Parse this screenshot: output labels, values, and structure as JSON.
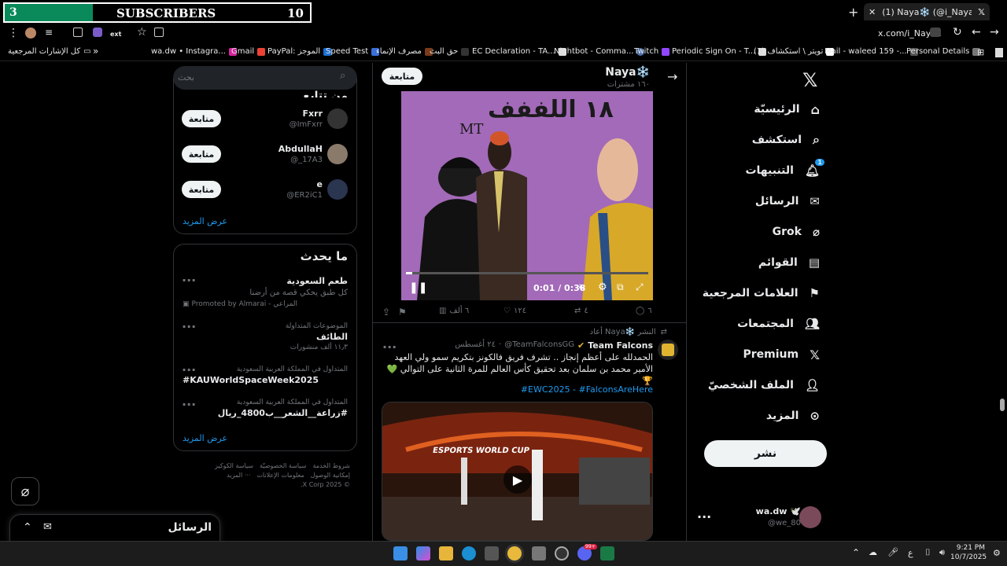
{
  "overlay": {
    "left": "3",
    "center": "SUBSCRIBERS",
    "right": "10"
  },
  "browser": {
    "tab_title": "(1) Naya❄️ (@i_Nayax) / X",
    "url": "x.com/i_Nayax",
    "new_tab": "+",
    "ext_label": "ext"
  },
  "bookmarks": [
    "كل الإشارات المرجعية",
    "wa.dw • Instagra...",
    "Gmail",
    "PayPal: الموجز",
    "Speed Test",
    "مصرف الإنماء",
    "حق البث",
    "EC Declaration - TA...",
    "Nightbot - Comma...",
    "Twitch",
    "Periodic Sign On - T...",
    "(1) تويتر \\ استكشاف",
    "Mail - waleed 159 -...",
    "Personal Details"
  ],
  "nav": {
    "items": [
      "الرئيسيّة",
      "استكشف",
      "التنبيهات",
      "الرسائل",
      "Grok",
      "القوائم",
      "العلامات المرجعية",
      "المجتمعات",
      "Premium",
      "الملف الشخصيّ",
      "المزيد"
    ],
    "post_button": "نشر",
    "notif_count": "1",
    "user_name": "wa.dw 🕊️",
    "user_handle": "@we_80"
  },
  "header": {
    "name": "Naya❄️",
    "posts": "١٦٠ مشترات",
    "follow": "متابعة"
  },
  "video1": {
    "caption": "١٨ اللففف",
    "mt": "MT",
    "time": "0:01 / 0:38"
  },
  "actions1": {
    "replies": "٦",
    "reposts": "٤",
    "likes": "١٢٤",
    "views": "٦ ألف"
  },
  "post2": {
    "reposted": "أعاد Naya❄️ النشر",
    "author": "Team Falcons",
    "handle": "@TeamFalconsGG",
    "date": "٢٤ أغسطس",
    "text": "الحمدلله على أعظم إنجاز .. تشرف فريق فالكونز بتكريم سمو ولي العهد الأمير محمد بن سلمان بعد تحقيق كأس العالم للمرة الثانية على التوالي 💚🏆",
    "tags": "#EWC2025 - #FalconsAreHere",
    "video_brand": "ESPORTS WORLD CUP"
  },
  "search": {
    "placeholder": "بحث"
  },
  "who": {
    "title": "من تتابع",
    "accounts": [
      {
        "name": "Fxrr",
        "handle": "@ImFxrr",
        "follow": "متابعة"
      },
      {
        "name": "AbdullaH",
        "handle": "@_17A3",
        "follow": "متابعة"
      },
      {
        "name": "e",
        "handle": "@ER2iC1",
        "follow": "متابعة"
      }
    ],
    "show_more": "عرض المزيد"
  },
  "trends": {
    "title": "ما يحدث",
    "items": [
      {
        "context": "",
        "title": "طعم السعودية",
        "sub": "كل طبق يحكي قصة من أرضنا",
        "promo": "Promoted by Almarai - المراعي"
      },
      {
        "context": "الموضوعات المتداولة",
        "title": "الطائف",
        "sub": "١١٫٣ ألف منشورات",
        "promo": ""
      },
      {
        "context": "المتداول في المملكة العربية السعودية",
        "title": "#KAUWorldSpaceWeek2025",
        "sub": "",
        "promo": ""
      },
      {
        "context": "المتداول في المملكة العربية السعودية",
        "title": "#زراعة__الشعر__ب4800_ريال",
        "sub": "",
        "promo": ""
      }
    ],
    "show_more": "عرض المزيد"
  },
  "footer": {
    "links": [
      "شروط الخدمة",
      "سياسة الخصوصيّة",
      "سياسة الكوكيز",
      "إمكانية الوصول",
      "معلومات الإعلانات",
      "··· المزيد"
    ],
    "copy": "© 2025 X Corp."
  },
  "messages": {
    "label": "الرسائل"
  },
  "taskbar": {
    "lang": "ع",
    "time": "9:21 PM",
    "date": "10/7/2025",
    "badge": "99+"
  }
}
